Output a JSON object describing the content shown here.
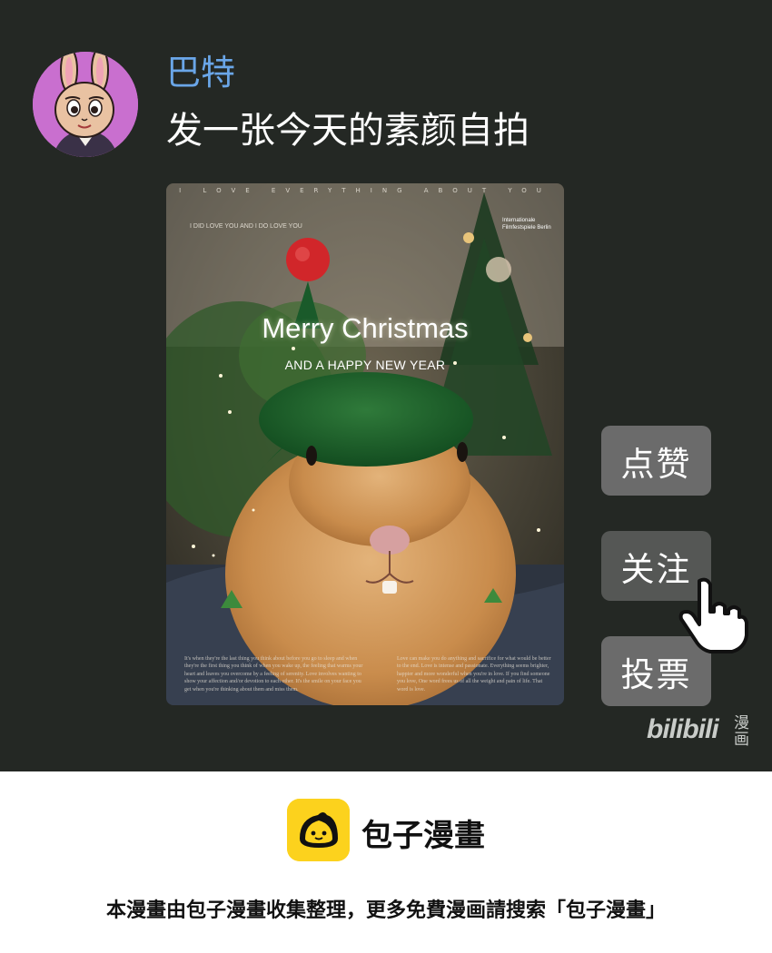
{
  "post": {
    "username": "巴特",
    "text": "发一张今天的素颜自拍",
    "avatar_icon": "cartoon-bunny-avatar"
  },
  "poster": {
    "top_text": "I LOVE EVERYTHING ABOUT YOU",
    "subtitle": "I DID LOVE YOU AND I DO LOVE YOU",
    "festival": "Internationale Filmfestspiele Berlin",
    "greeting": "Merry Christmas",
    "subgreeting": "AND A HAPPY NEW YEAR",
    "foot_left": "It's when they're the last thing you think about before you go to sleep and when they're the first thing you think of when you wake up, the feeling that warms your heart and leaves you overcome by a feeling of serenity. Love involves wanting to show your affection and/or devotion to each other. It's the smile on your face you get when you're thinking about them and miss them.",
    "foot_right": "Love can make you do anything and sacrifice for what would be better to the end. Love is intense and passionate. Everything seems brighter, happier and more wonderful when you're in love. If you find someone you love, One word frees us of all the weight and pain of life. That word is love."
  },
  "actions": {
    "like": "点赞",
    "follow": "关注",
    "vote": "投票"
  },
  "watermark": {
    "text": "bilibili",
    "cn": "漫画"
  },
  "footer": {
    "brand": "包子漫畫",
    "note": "本漫畫由包子漫畫收集整理，更多免費漫画請搜索「包子漫畫」"
  },
  "colors": {
    "panel_bg": "#242824",
    "username": "#6aa6e8",
    "button_bg": "#6b6b6b",
    "brand_yellow": "#fcd21d"
  }
}
